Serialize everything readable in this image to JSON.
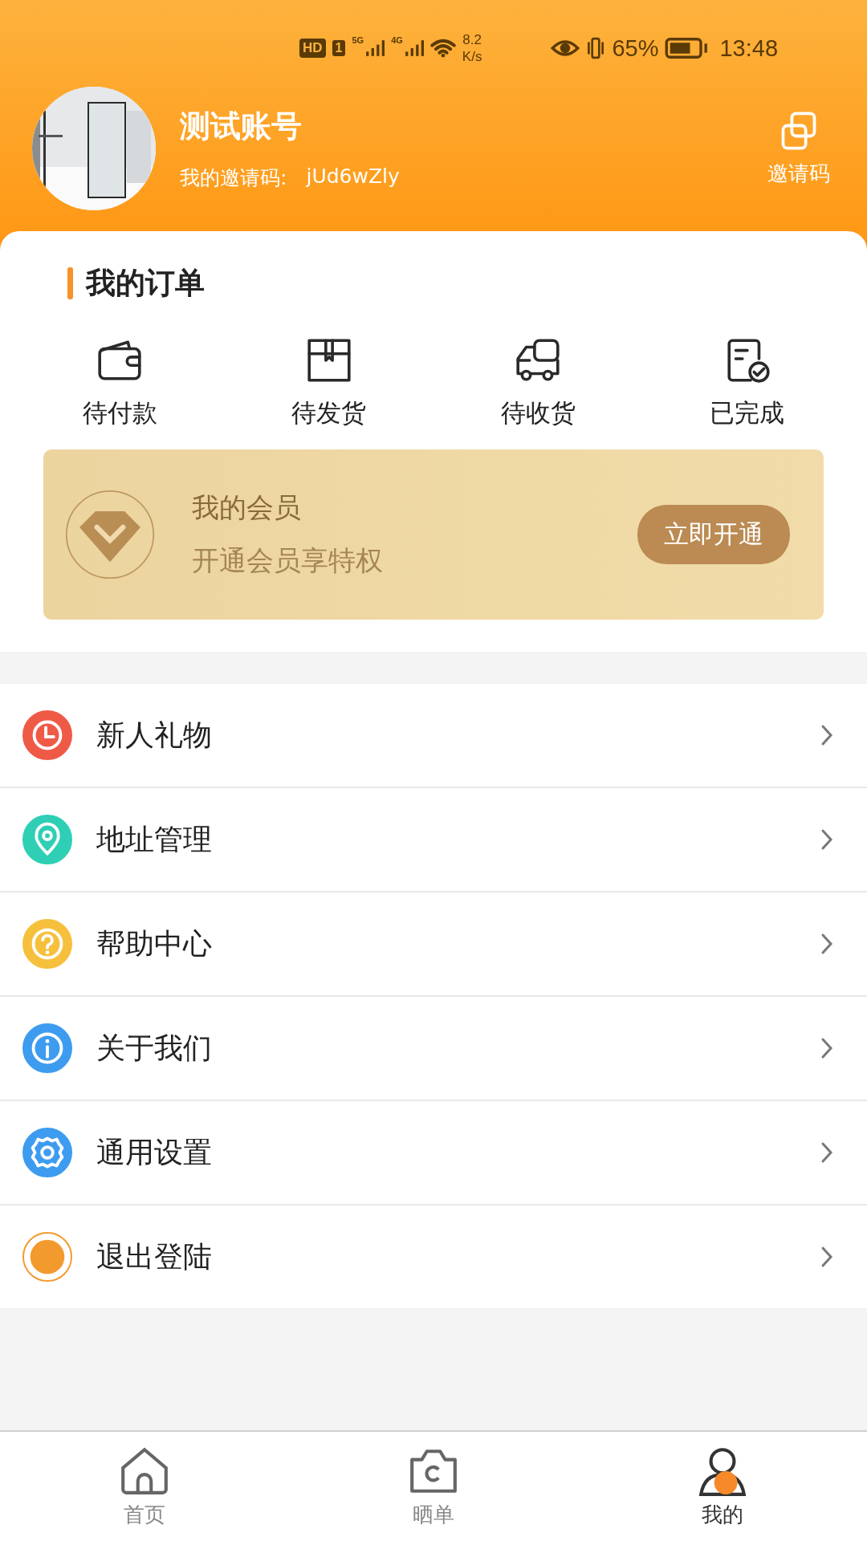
{
  "status_bar": {
    "hd": "HD",
    "sim": "1",
    "net1": "5G",
    "net2": "4G",
    "speed_value": "8.2",
    "speed_unit": "K/s",
    "battery": "65%",
    "time": "13:48"
  },
  "profile": {
    "name": "测试账号",
    "invite_label": "我的邀请码:",
    "invite_code": "jUd6wZly",
    "invite_button": "邀请码"
  },
  "orders": {
    "title": "我的订单",
    "items": [
      {
        "kind": "wallet",
        "label": "待付款"
      },
      {
        "kind": "box",
        "label": "待发货"
      },
      {
        "kind": "truck",
        "label": "待收货"
      },
      {
        "kind": "done",
        "label": "已完成"
      }
    ]
  },
  "membership": {
    "title": "我的会员",
    "subtitle": "开通会员享特权",
    "button": "立即开通"
  },
  "menu": [
    {
      "kind": "clock",
      "label": "新人礼物",
      "color": "#ef5a47"
    },
    {
      "kind": "pin",
      "label": "地址管理",
      "color": "#2ecfb5"
    },
    {
      "kind": "help",
      "label": "帮助中心",
      "color": "#f6c03d"
    },
    {
      "kind": "info",
      "label": "关于我们",
      "color": "#3d9cf0"
    },
    {
      "kind": "gear",
      "label": "通用设置",
      "color": "#3d9cf0"
    },
    {
      "kind": "dot",
      "label": "退出登陆",
      "color": "#f39a2e"
    }
  ],
  "tab_bar": [
    {
      "kind": "home",
      "label": "首页",
      "selected": false
    },
    {
      "kind": "camera",
      "label": "晒单",
      "selected": false
    },
    {
      "kind": "person",
      "label": "我的",
      "selected": true
    }
  ]
}
